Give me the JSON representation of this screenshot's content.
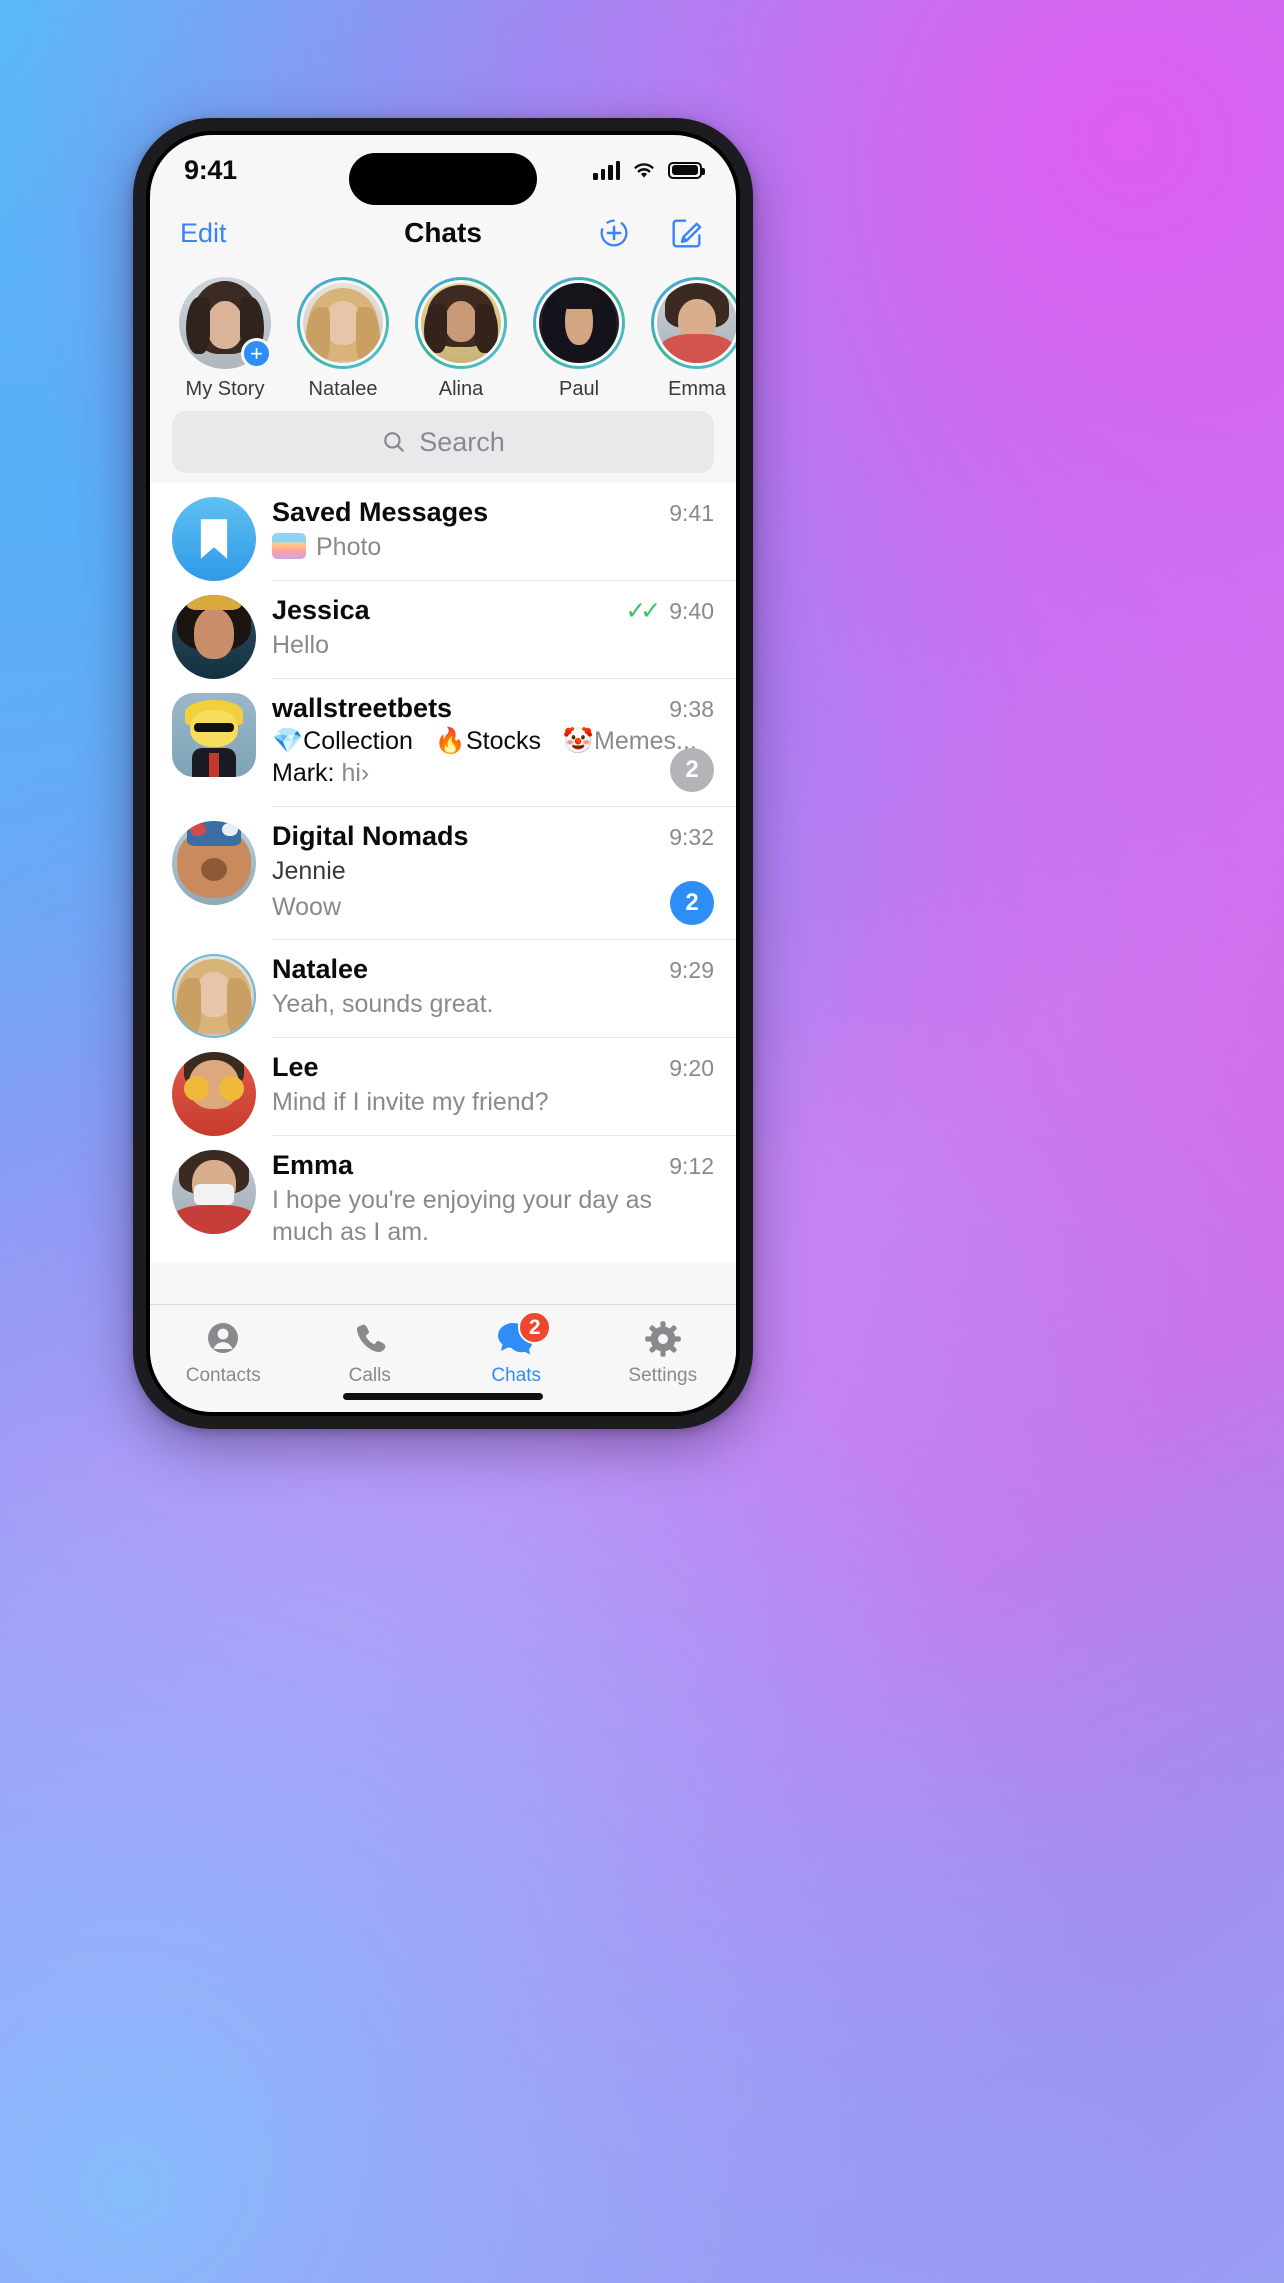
{
  "status_bar": {
    "time": "9:41",
    "signal_icon": "cellular-bars-icon",
    "wifi_icon": "wifi-icon",
    "battery_icon": "battery-icon"
  },
  "nav": {
    "edit_label": "Edit",
    "title": "Chats",
    "add_story_icon": "add-story-circle-plus-icon",
    "compose_icon": "compose-pencil-square-icon"
  },
  "stories": [
    {
      "name": "My Story",
      "has_ring": false,
      "has_plus": true
    },
    {
      "name": "Natalee",
      "has_ring": true,
      "has_plus": false
    },
    {
      "name": "Alina",
      "has_ring": true,
      "has_plus": false
    },
    {
      "name": "Paul",
      "has_ring": true,
      "has_plus": false
    },
    {
      "name": "Emma",
      "has_ring": true,
      "has_plus": false
    }
  ],
  "search": {
    "placeholder": "Search",
    "icon": "search-icon"
  },
  "chats": [
    {
      "name": "Saved Messages",
      "time": "9:41",
      "preview": "Photo",
      "preview_icon": "photo-thumbnail-icon",
      "avatar_kind": "saved-bookmark",
      "badge": null,
      "read_ticks": false
    },
    {
      "name": "Jessica",
      "time": "9:40",
      "preview": "Hello",
      "avatar_kind": "photo",
      "badge": null,
      "read_ticks": true
    },
    {
      "name": "wallstreetbets",
      "time": "9:38",
      "tags": [
        {
          "emoji": "💎",
          "label": "Collection",
          "active": true
        },
        {
          "emoji": "🔥",
          "label": "Stocks",
          "active": true
        },
        {
          "emoji": "🤡",
          "label": "Memes...",
          "active": false
        }
      ],
      "from": "Mark:",
      "from_message": "hi",
      "from_chevron": "›",
      "avatar_kind": "square-photo",
      "badge": "2",
      "badge_color": "grey"
    },
    {
      "name": "Digital Nomads",
      "time": "9:32",
      "sender": "Jennie",
      "preview": "Woow",
      "avatar_kind": "photo",
      "badge": "2",
      "badge_color": "blue"
    },
    {
      "name": "Natalee",
      "time": "9:29",
      "preview": "Yeah, sounds great.",
      "avatar_kind": "photo-ring",
      "badge": null
    },
    {
      "name": "Lee",
      "time": "9:20",
      "preview": "Mind if I invite my friend?",
      "avatar_kind": "photo",
      "badge": null
    },
    {
      "name": "Emma",
      "time": "9:12",
      "preview": "I hope you're enjoying your day as much as I am.",
      "avatar_kind": "photo",
      "badge": null
    }
  ],
  "tabs": [
    {
      "label": "Contacts",
      "icon": "contacts-person-icon",
      "active": false,
      "badge": null
    },
    {
      "label": "Calls",
      "icon": "phone-handset-icon",
      "active": false,
      "badge": null
    },
    {
      "label": "Chats",
      "icon": "chat-bubbles-icon",
      "active": true,
      "badge": "2"
    },
    {
      "label": "Settings",
      "icon": "gear-icon",
      "active": false,
      "badge": null
    }
  ],
  "colors": {
    "accent_blue": "#2e8ef5",
    "link_blue": "#3b82f6",
    "badge_red": "#f0462d",
    "tick_green": "#34c759",
    "grey_badge": "#b4b4b8"
  }
}
